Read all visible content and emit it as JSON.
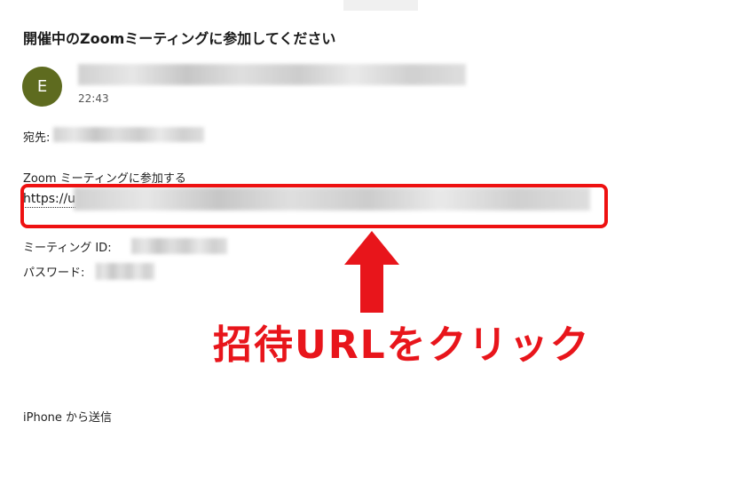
{
  "email": {
    "subject": "開催中のZoomミーティングに参加してください",
    "sender_initial": "E",
    "time": "22:43",
    "to_label": "宛先:",
    "join_label": "Zoom ミーティングに参加する",
    "url_prefix": "https://u",
    "meeting_id_label": "ミーティング ID:",
    "password_label": "パスワード:",
    "signature": "iPhone から送信"
  },
  "annotation": {
    "callout_text": "招待URLをクリック",
    "color": "#e8151b",
    "arrow_icon": "up-arrow-icon"
  },
  "colors": {
    "avatar_bg": "#5e6b1f",
    "highlight": "#ee1111"
  }
}
